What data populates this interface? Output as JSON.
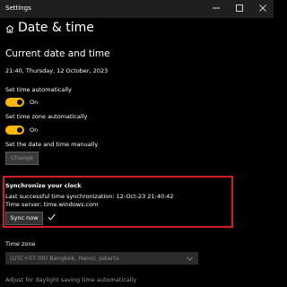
{
  "window": {
    "app_title": "Settings"
  },
  "header": {
    "title": "Date & time"
  },
  "current": {
    "section_title": "Current date and time",
    "datetime": "21:40, Thursday, 12 October, 2023"
  },
  "settings": {
    "set_time_auto": {
      "label": "Set time automatically",
      "state": "On",
      "on": true
    },
    "set_timezone_auto": {
      "label": "Set time zone automatically",
      "state": "On",
      "on": true
    },
    "manual": {
      "label": "Set the date and time manually",
      "button": "Change"
    }
  },
  "sync": {
    "title": "Synchronize your clock",
    "last_sync": "Last successful time synchronization: 12-Oct-23 21:40:42",
    "server": "Time server: time.windows.com",
    "button": "Sync now"
  },
  "timezone": {
    "label": "Time zone",
    "value": "(UTC+07:00) Bangkok, Hanoi, Jakarta"
  },
  "dst": {
    "label": "Adjust for daylight saving time automatically"
  },
  "colors": {
    "toggle_on": "#ffb900",
    "highlight_border": "#d21f26",
    "background": "#000000"
  },
  "icons": {
    "home": "home-icon",
    "check": "check-icon",
    "chevron": "chevron-down-icon"
  }
}
